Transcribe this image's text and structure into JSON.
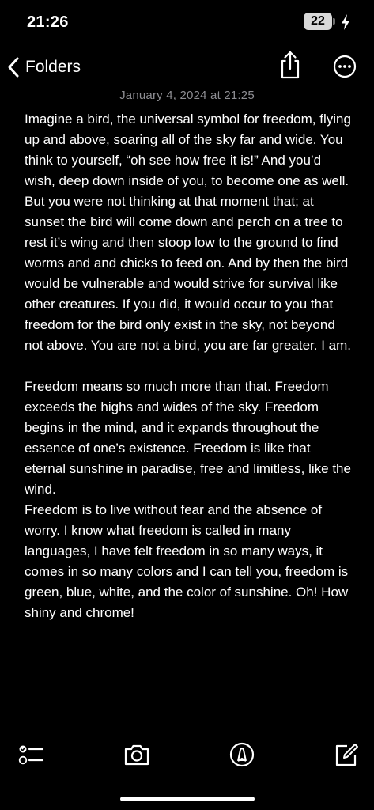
{
  "status_bar": {
    "time": "21:26",
    "battery_level": "22",
    "charging_icon": "lightning-bolt-icon"
  },
  "nav": {
    "back_label": "Folders",
    "back_icon": "chevron-left-icon",
    "share_icon": "share-icon",
    "more_icon": "ellipsis-circle-icon"
  },
  "note": {
    "date": "January 4, 2024 at 21:25",
    "paragraphs": [
      "Imagine a bird, the universal symbol for freedom, flying up and above, soaring all of the sky far and wide. You think to yourself, “oh see how free it is!” And you’d wish, deep down inside of you, to become one as well. But you were not thinking at that moment that; at sunset the bird will come down and perch on a tree to rest it’s wing and then stoop low to the ground to find worms and and chicks to feed on. And by then the bird would be vulnerable and would strive for survival like other creatures. If you did, it would occur to you that freedom for the bird only exist in the sky, not beyond not above. You are not a bird, you are far greater. I am.",
      "Freedom means so much more than that. Freedom exceeds the highs and wides of the sky. Freedom begins in the mind, and it expands throughout the essence of one’s existence. Freedom is like that eternal sunshine in paradise, free and limitless, like the wind.",
      "Freedom is to live without fear and the absence of worry. I know what freedom is called in many languages, I have felt freedom in so many ways, it comes in so many colors and I can tell you, freedom is green, blue, white, and the color of sunshine. Oh! How shiny and chrome!"
    ]
  },
  "toolbar": {
    "items": [
      "checklist-icon",
      "camera-icon",
      "markup-pen-icon",
      "compose-icon"
    ]
  },
  "colors": {
    "background": "#000000",
    "text": "#ffffff",
    "secondary_text": "#8e8e93"
  }
}
